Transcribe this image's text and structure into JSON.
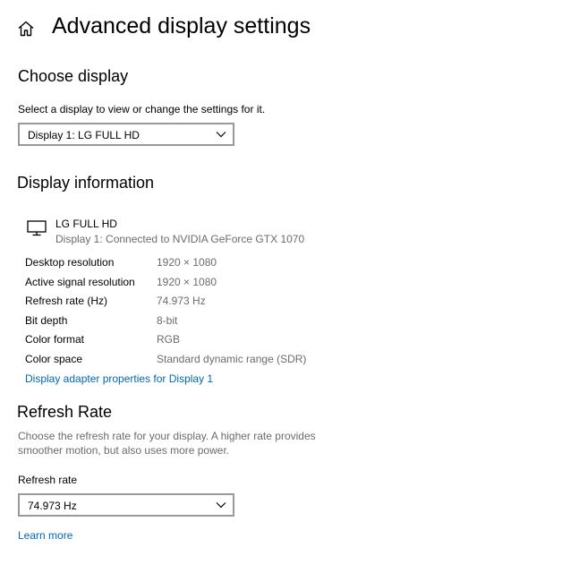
{
  "header": {
    "title": "Advanced display settings"
  },
  "choose_display": {
    "heading": "Choose display",
    "prompt": "Select a display to view or change the settings for it.",
    "selected": "Display 1: LG FULL HD"
  },
  "display_info": {
    "heading": "Display information",
    "monitor_name": "LG FULL HD",
    "monitor_subtitle": "Display 1: Connected to NVIDIA GeForce GTX 1070",
    "rows": [
      {
        "label": "Desktop resolution",
        "value": "1920 × 1080"
      },
      {
        "label": "Active signal resolution",
        "value": "1920 × 1080"
      },
      {
        "label": "Refresh rate (Hz)",
        "value": "74.973 Hz"
      },
      {
        "label": "Bit depth",
        "value": "8-bit"
      },
      {
        "label": "Color format",
        "value": "RGB"
      },
      {
        "label": "Color space",
        "value": "Standard dynamic range (SDR)"
      }
    ],
    "adapter_link": "Display adapter properties for Display 1"
  },
  "refresh_rate": {
    "heading": "Refresh Rate",
    "description_line1": "Choose the refresh rate for your display. A higher rate provides",
    "description_line2": "smoother motion, but also uses more power.",
    "field_label": "Refresh rate",
    "selected": "74.973 Hz",
    "learn_more": "Learn more"
  },
  "icons": {
    "home": "home-icon",
    "monitor": "monitor-icon",
    "chevron": "chevron-down-icon"
  },
  "colors": {
    "link": "#0067b8",
    "muted_text": "#6b6b6b",
    "dropdown_border": "#999999"
  }
}
